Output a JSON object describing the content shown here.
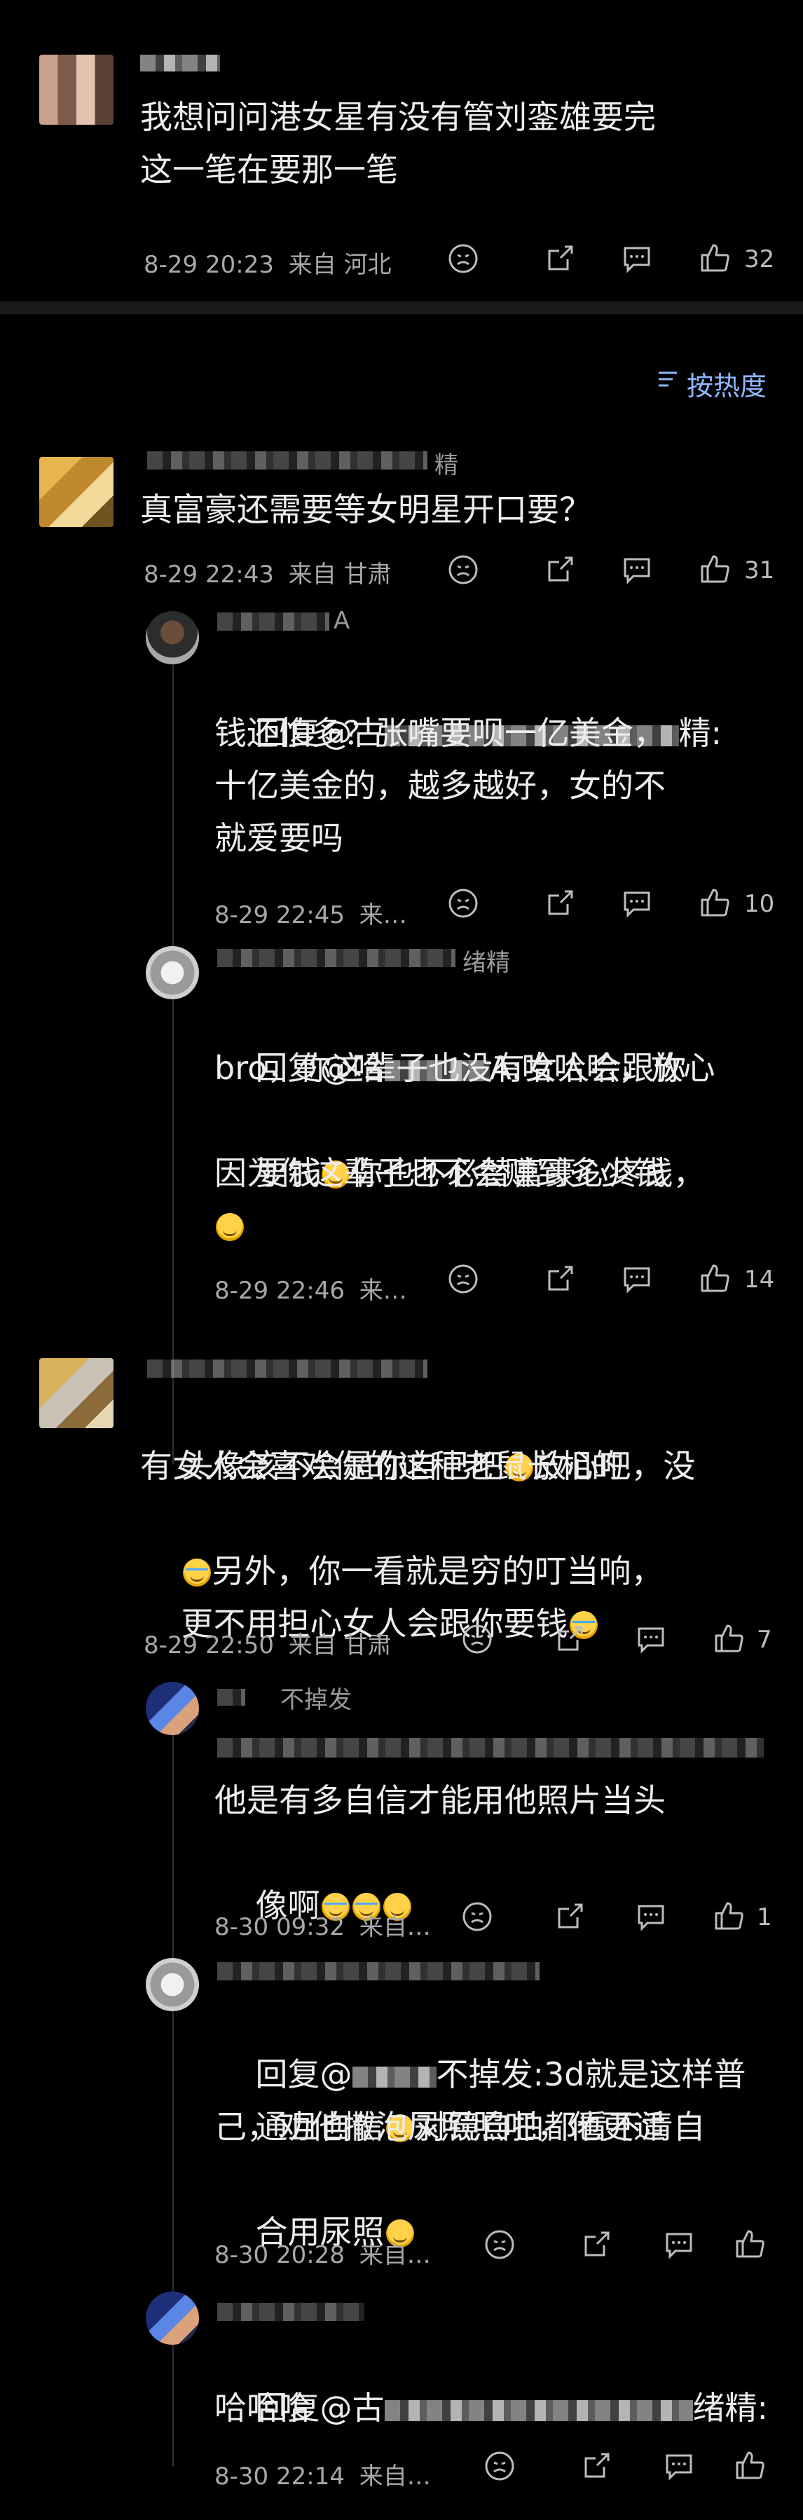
{
  "comments": [
    {
      "id": "top",
      "text": "我想问问港女星有没有管刘銮雄要完\n这一笔在要那一笔",
      "date": "8-29 20:23",
      "location": "来自 河北",
      "likes": "32"
    },
    {
      "id": "c1",
      "name_suffix": "精",
      "text": "真富豪还需要等女明星开口要？",
      "date": "8-29 22:43",
      "location": "来自 甘肃",
      "likes": "31",
      "replies": [
        {
          "name_suffix": "A",
          "prefix": "回复",
          "mention": "@古",
          "mention_tail": "精:",
          "text_line1": "钱还怕多？张嘴要呗一亿美金，",
          "text_line2": "十亿美金的，越多越好，女的不",
          "text_line3": "就爱要吗",
          "date": "8-29 22:45",
          "location": "来…",
          "likes": "10"
        },
        {
          "name_suffix": "绪精",
          "prefix": "回复",
          "mention": "@哈",
          "mention_tail": "A:",
          "text_line1": "哈哈哈，放心",
          "text_line2": "bro，你这辈子也没有女人会跟你",
          "text_line3": "要钱",
          "text_line3b": "你也不必替富豪心疼钱，",
          "text_line4": "因为你这辈子也不会赚到多少钱",
          "date": "8-29 22:46",
          "location": "来…",
          "likes": "14"
        }
      ]
    },
    {
      "id": "c2",
      "text_line1": "头像该不会是你自己吧",
      "text_line1b": "放心吧，没",
      "text_line2": "有女人会喜欢你的这种老鼠长相的",
      "text_line3": "另外，你一看就是穷的叮当响，",
      "text_line4": "更不用担心女人会跟你要钱",
      "date": "8-29 22:50",
      "location": "来自 甘肃",
      "likes": "7",
      "replies": [
        {
          "name": "不掉发",
          "text_line1": "他是有多自信才能用他照片当头",
          "text_line2": "像啊",
          "date": "8-30 09:32",
          "location": "来自…",
          "likes": "1"
        },
        {
          "prefix": "回复",
          "mention": "@",
          "mention_tail": "不掉发:",
          "text_line1a": "3d就是这样普",
          "text_line2": "通且自信",
          "text_line2b": "对镜自拍都看不清自",
          "text_line3": "己，劝他撒泡尿照照吧，他更适",
          "text_line4": "合用尿照",
          "date": "8-30 20:28",
          "location": "来自…"
        },
        {
          "prefix": "回复",
          "mention": "@古",
          "mention_tail": "绪精:",
          "text_line2": "哈哈哈",
          "date": "8-30 22:14",
          "location": "来自…"
        }
      ]
    }
  ],
  "sort_label": "按热度",
  "icons": [
    "dislike-icon",
    "share-icon",
    "comment-icon",
    "like-icon",
    "sort-icon"
  ]
}
